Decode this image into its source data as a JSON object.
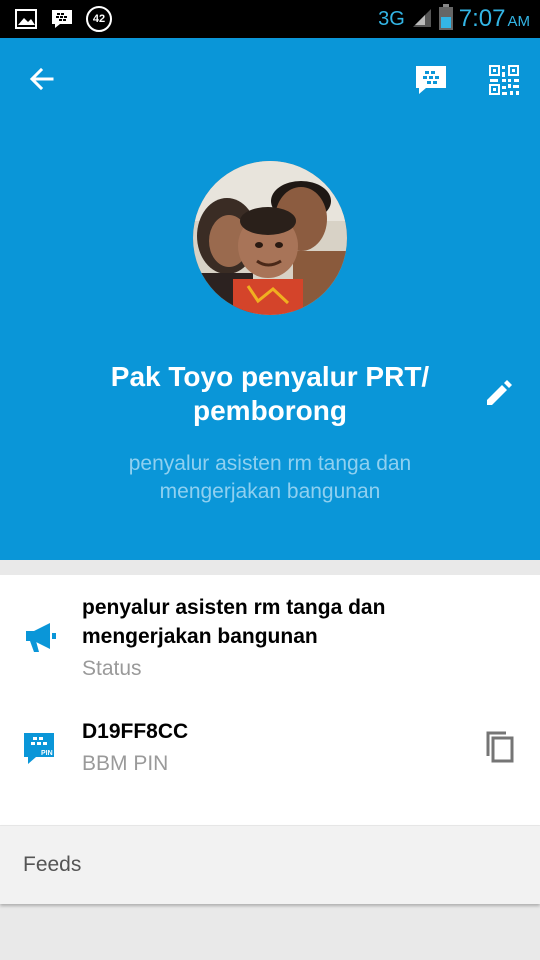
{
  "status_bar": {
    "notification_count": "42",
    "network": "3G",
    "time": "7:07",
    "ampm": "AM"
  },
  "profile": {
    "name": "Pak Toyo penyalur PRT/ pemborong",
    "subtitle": "penyalur asisten rm tanga dan mengerjakan bangunan"
  },
  "details": {
    "status_value": "penyalur asisten rm tanga dan mengerjakan bangunan",
    "status_label": "Status",
    "pin_value": "D19FF8CC",
    "pin_label": "BBM PIN",
    "pin_icon_text": "PIN"
  },
  "feeds": {
    "label": "Feeds"
  },
  "colors": {
    "header": "#0a96d8",
    "accent": "#0a96d8"
  }
}
